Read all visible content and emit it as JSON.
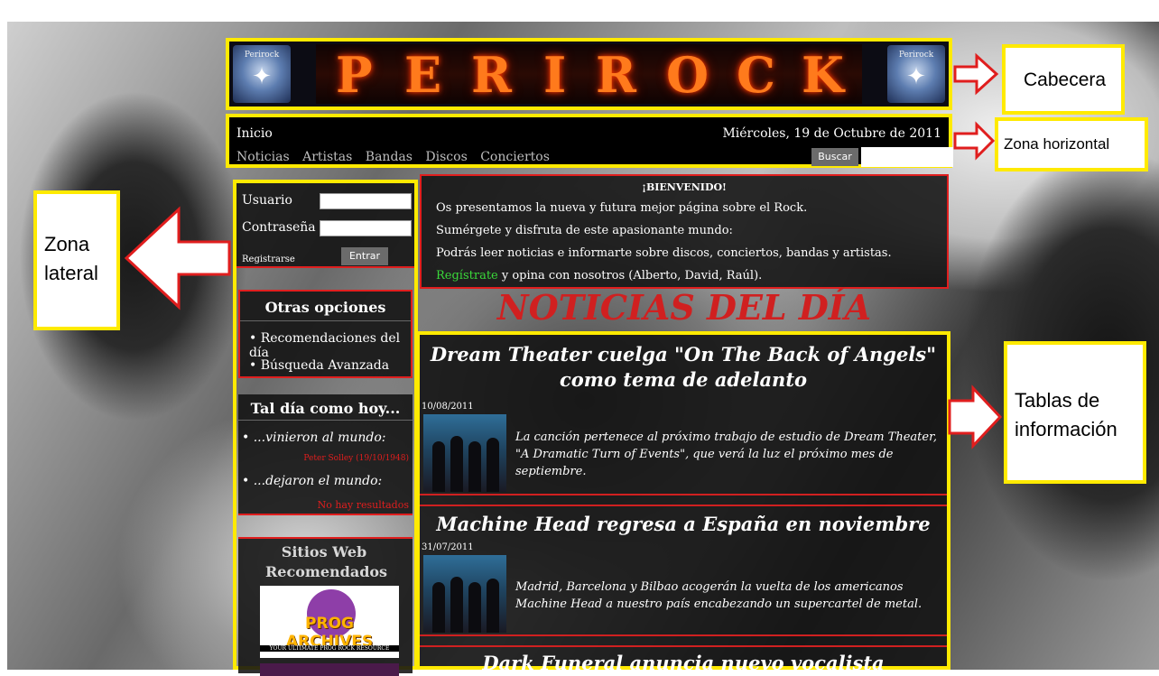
{
  "header": {
    "logo_text": "Perirock",
    "banner_letters": [
      "P",
      "E",
      "R",
      "I",
      "R",
      "O",
      "C",
      "K"
    ]
  },
  "nav": {
    "home": "Inicio",
    "date": "Miércoles, 19 de Octubre de 2011",
    "menu": [
      "Noticias",
      "Artistas",
      "Bandas",
      "Discos",
      "Conciertos"
    ],
    "search_button": "Buscar"
  },
  "sidebar": {
    "login": {
      "user_label": "Usuario",
      "password_label": "Contraseña",
      "register_link": "Registrarse",
      "submit": "Entrar"
    },
    "options": {
      "title": "Otras opciones",
      "items": [
        "Recomendaciones del día",
        "Búsqueda Avanzada"
      ]
    },
    "this_day": {
      "title": "Tal día como hoy...",
      "born_label": "...vinieron al mundo:",
      "born_result": "Peter Solley (19/10/1948)",
      "died_label": "...dejaron el mundo:",
      "died_result": "No hay resultados"
    },
    "sites": {
      "title": "Sitios Web Recomendados",
      "banner1": "PROG ARCHIVES",
      "banner1_sub": "YOUR ULTIMATE PROG ROCK RESOURCE"
    }
  },
  "welcome": {
    "title": "¡BIENVENIDO!",
    "line1": "Os presentamos la nueva y futura mejor página sobre el Rock.",
    "line2": "Sumérgete y disfruta de este apasionante mundo:",
    "line3": "Podrás leer noticias e informarte sobre discos, conciertos, bandas y artistas.",
    "register_link": "Regístrate",
    "line4_rest": " y opina con nosotros (Alberto, David, Raúl)."
  },
  "news_heading": "NOTICIAS DEL DÍA",
  "news": [
    {
      "title": "Dream Theater cuelga \"On The Back of Angels\" como tema de adelanto",
      "date": "10/08/2011",
      "text": "La canción pertenece al próximo trabajo de estudio de Dream Theater, \"A Dramatic Turn of Events\", que verá la luz el próximo mes de septiembre."
    },
    {
      "title": "Machine Head regresa a España en noviembre",
      "date": "31/07/2011",
      "text": "Madrid, Barcelona y Bilbao acogerán la vuelta de los americanos Machine Head a nuestro país encabezando un supercartel de metal."
    },
    {
      "title": "Dark Funeral anuncia nuevo vocalista",
      "date": "",
      "text": ""
    }
  ],
  "annotations": {
    "cabecera": "Cabecera",
    "zona_horizontal": "Zona horizontal",
    "zona_lateral": "Zona lateral",
    "tablas": "Tablas de información"
  },
  "colors": {
    "highlight": "#ffea00",
    "accent_red": "#e01e1e",
    "link_green": "#3ad93a"
  }
}
